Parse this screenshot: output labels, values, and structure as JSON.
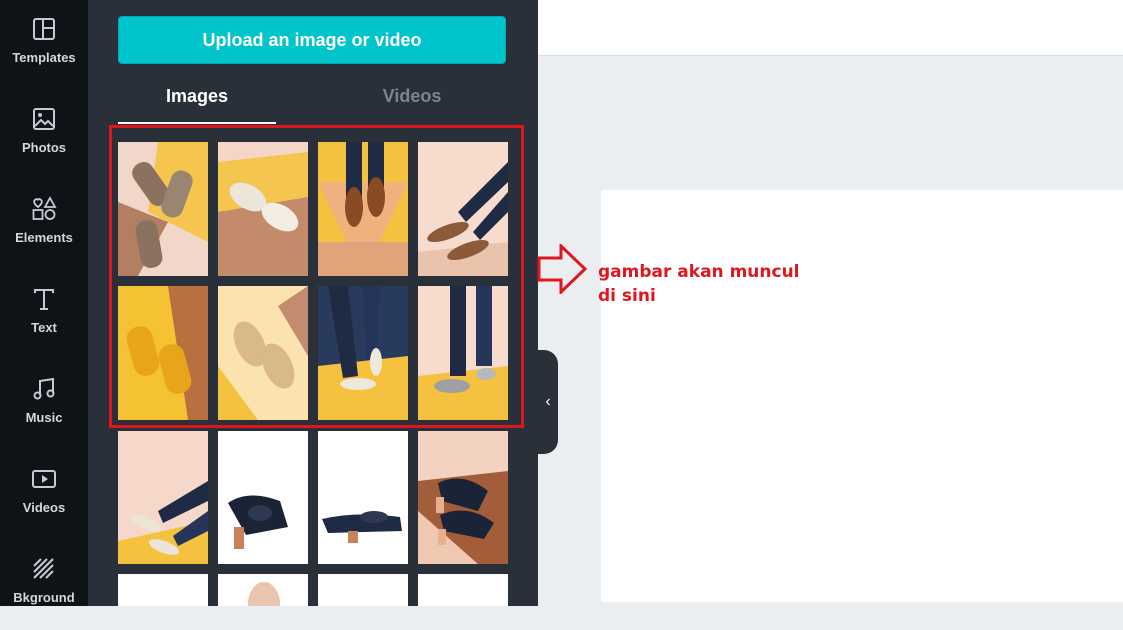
{
  "sidebar": {
    "items": [
      {
        "label": "Templates",
        "icon": "templates-icon"
      },
      {
        "label": "Photos",
        "icon": "photos-icon"
      },
      {
        "label": "Elements",
        "icon": "elements-icon"
      },
      {
        "label": "Text",
        "icon": "text-icon"
      },
      {
        "label": "Music",
        "icon": "music-icon"
      },
      {
        "label": "Videos",
        "icon": "videos-icon"
      },
      {
        "label": "Bkground",
        "icon": "background-icon"
      }
    ]
  },
  "panel": {
    "upload_label": "Upload an image or video",
    "tabs": [
      {
        "label": "Images",
        "active": true
      },
      {
        "label": "Videos",
        "active": false
      }
    ],
    "collapse_icon": "chevron-left-icon"
  },
  "annotation": {
    "text": "gambar akan muncul di sini",
    "color": "#e0161e"
  },
  "colors": {
    "accent": "#00c4cc",
    "panel_bg": "#293039",
    "rail_bg": "#0e1318",
    "highlight": "#e0161e"
  }
}
